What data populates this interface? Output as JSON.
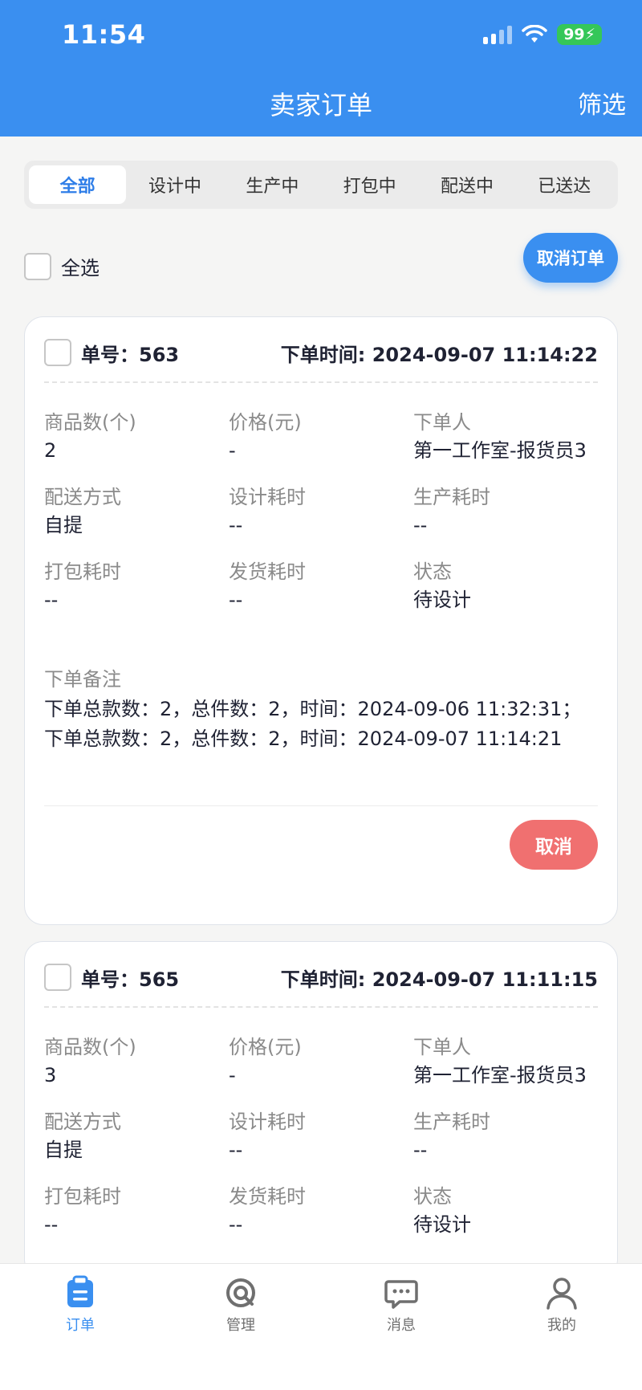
{
  "status_bar": {
    "time": "11:54",
    "battery": "99"
  },
  "nav": {
    "title": "卖家订单",
    "filter": "筛选"
  },
  "tabs": [
    {
      "label": "全部",
      "active": true
    },
    {
      "label": "设计中"
    },
    {
      "label": "生产中"
    },
    {
      "label": "打包中"
    },
    {
      "label": "配送中"
    },
    {
      "label": "已送达"
    }
  ],
  "toolbar": {
    "select_all": "全选",
    "cancel_orders": "取消订单"
  },
  "orders": [
    {
      "order_no": "单号：563",
      "order_time": "下单时间: 2024-09-07 11:14:22",
      "fields": [
        {
          "label": "商品数(个)",
          "value": "2"
        },
        {
          "label": "价格(元)",
          "value": "-"
        },
        {
          "label": "下单人",
          "value": "第一工作室-报货员3"
        },
        {
          "label": "配送方式",
          "value": "自提"
        },
        {
          "label": "设计耗时",
          "value": "--"
        },
        {
          "label": "生产耗时",
          "value": "--"
        },
        {
          "label": "打包耗时",
          "value": "--"
        },
        {
          "label": "发货耗时",
          "value": "--"
        },
        {
          "label": "状态",
          "value": "待设计"
        }
      ],
      "remark_label": "下单备注",
      "remark": "下单总款数：2，总件数：2，时间：2024-09-06 11:32:31；下单总款数：2，总件数：2，时间：2024-09-07 11:14:21",
      "cancel": "取消"
    },
    {
      "order_no": "单号：565",
      "order_time": "下单时间: 2024-09-07 11:11:15",
      "fields": [
        {
          "label": "商品数(个)",
          "value": "3"
        },
        {
          "label": "价格(元)",
          "value": "-"
        },
        {
          "label": "下单人",
          "value": "第一工作室-报货员3"
        },
        {
          "label": "配送方式",
          "value": "自提"
        },
        {
          "label": "设计耗时",
          "value": "--"
        },
        {
          "label": "生产耗时",
          "value": "--"
        },
        {
          "label": "打包耗时",
          "value": "--"
        },
        {
          "label": "发货耗时",
          "value": "--"
        },
        {
          "label": "状态",
          "value": "待设计"
        }
      ]
    }
  ],
  "tabbar": [
    {
      "label": "订单",
      "icon": "clipboard-icon",
      "active": true
    },
    {
      "label": "管理",
      "icon": "manage-icon"
    },
    {
      "label": "消息",
      "icon": "message-icon"
    },
    {
      "label": "我的",
      "icon": "user-icon"
    }
  ],
  "colors": {
    "primary": "#3a8ff0",
    "danger": "#f07070"
  }
}
